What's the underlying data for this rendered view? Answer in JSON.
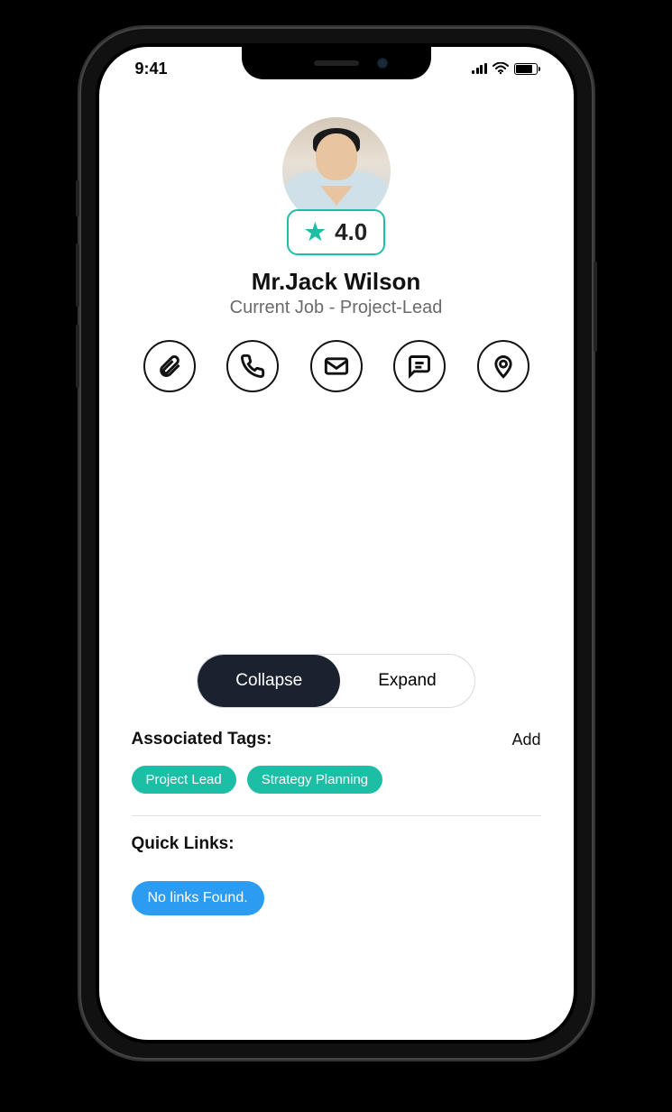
{
  "status": {
    "time": "9:41"
  },
  "profile": {
    "name": "Mr.Jack Wilson",
    "job": "Current Job - Project-Lead",
    "rating": "4.0"
  },
  "actions": [
    {
      "id": "attachment"
    },
    {
      "id": "phone"
    },
    {
      "id": "email"
    },
    {
      "id": "message"
    },
    {
      "id": "location"
    }
  ],
  "toggle": {
    "collapse": "Collapse",
    "expand": "Expand",
    "active": "collapse"
  },
  "tags": {
    "title": "Associated Tags:",
    "add": "Add",
    "items": [
      "Project Lead",
      "Strategy Planning"
    ]
  },
  "links": {
    "title": "Quick Links:",
    "empty": "No links Found."
  }
}
